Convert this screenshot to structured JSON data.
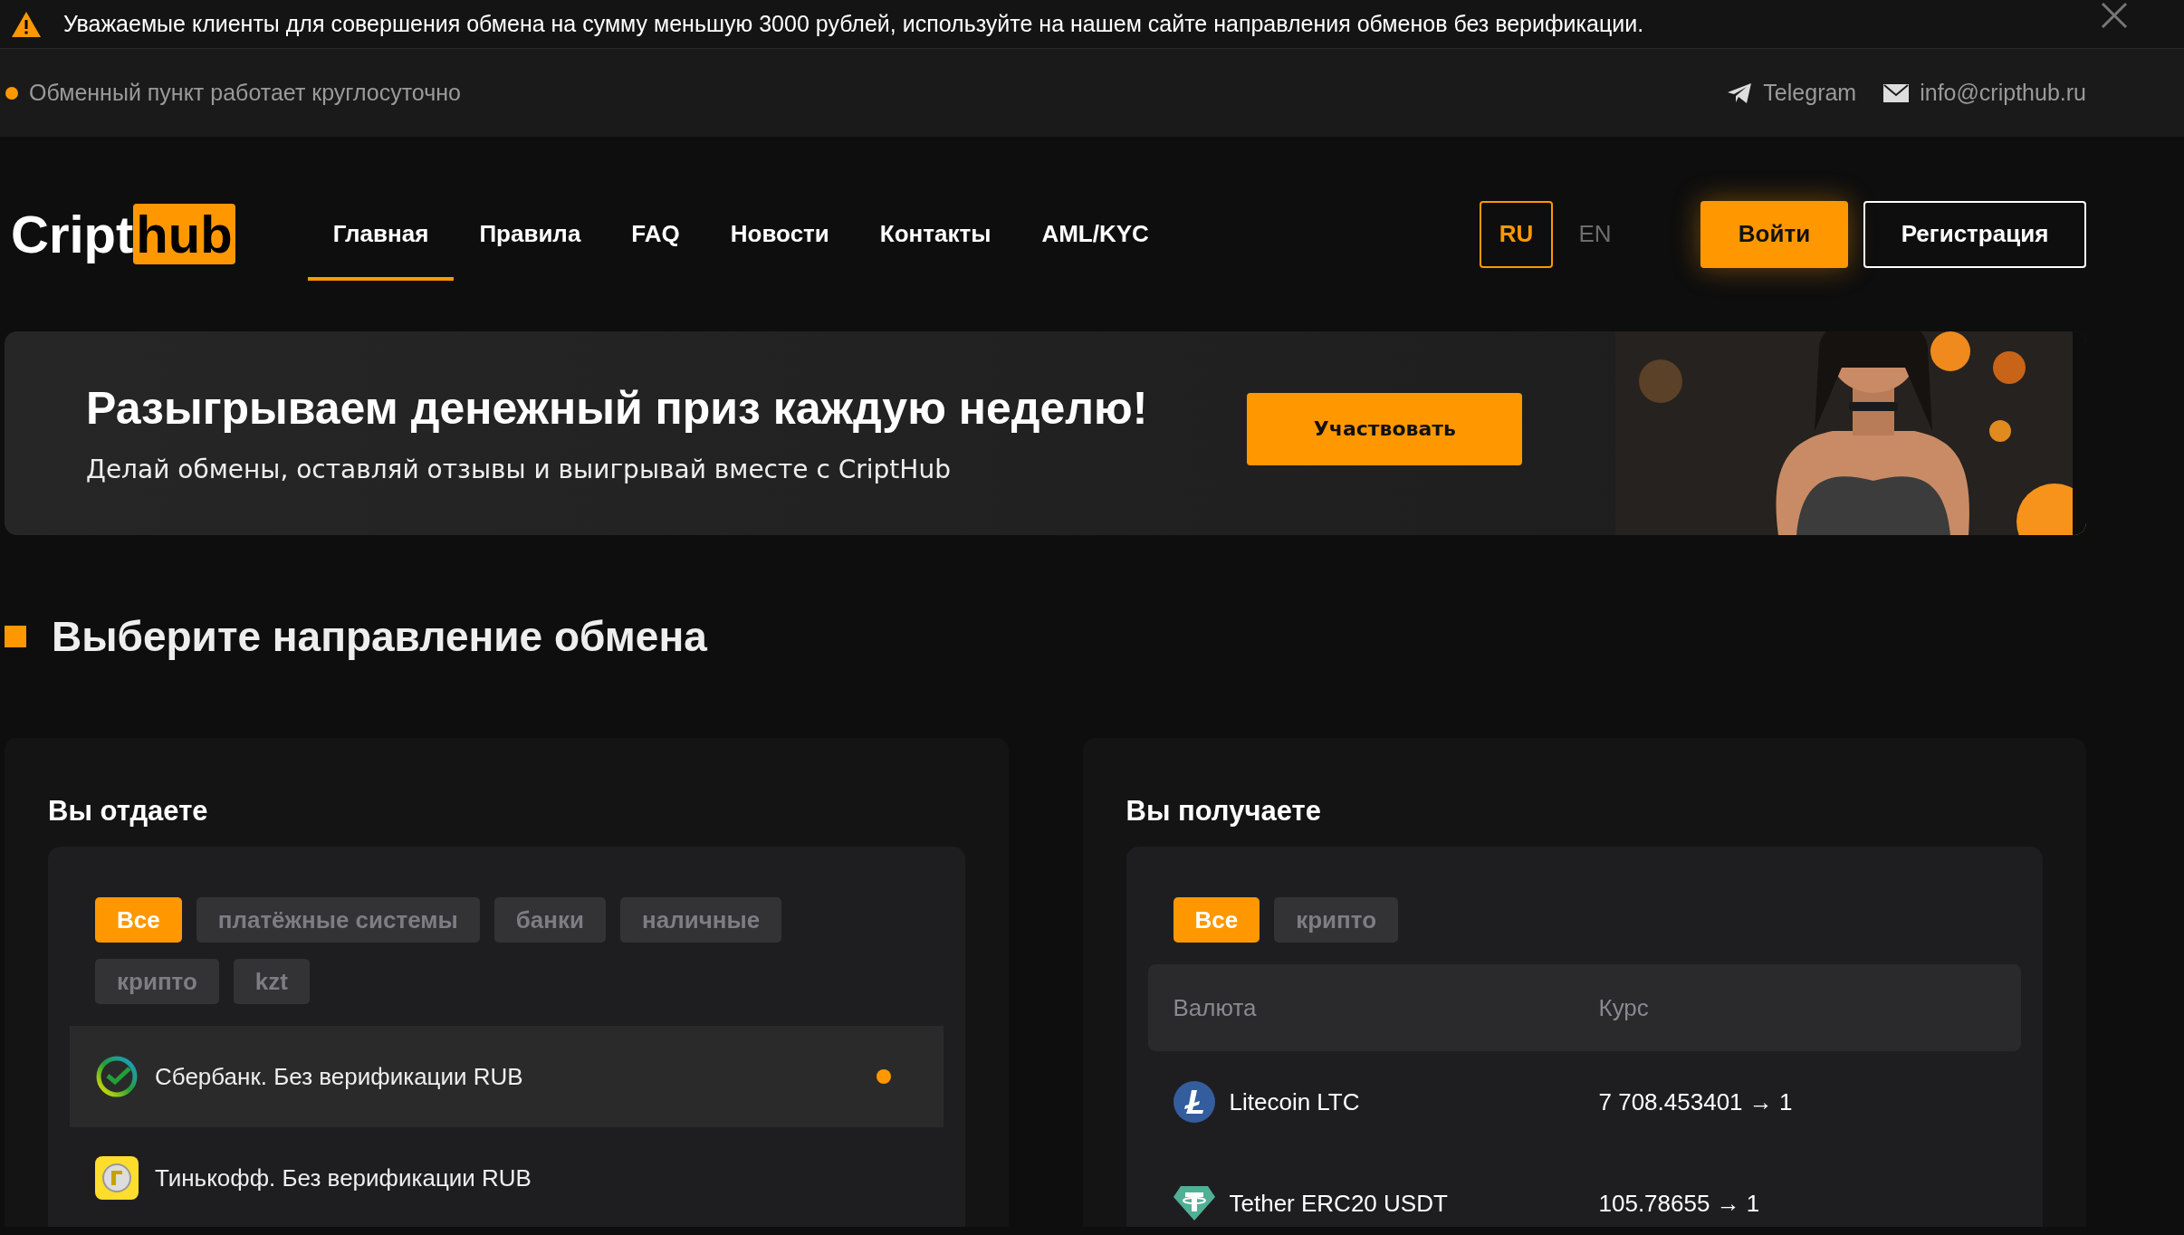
{
  "notice": {
    "text": "Уважаемые клиенты для совершения обмена на сумму меньшую 3000 рублей, используйте на нашем сайте направления обменов без верификации."
  },
  "info_bar": {
    "status": "Обменный пункт работает круглосуточно",
    "links": [
      "Telegram",
      "info@cripthub.ru"
    ]
  },
  "header": {
    "logo": {
      "part_1": "Cript",
      "part_2": "hub"
    },
    "nav": [
      {
        "label": "Главная",
        "selected": true
      },
      {
        "label": "Правила",
        "selected": false
      },
      {
        "label": "FAQ",
        "selected": false
      },
      {
        "label": "Новости",
        "selected": false
      },
      {
        "label": "Контакты",
        "selected": false
      },
      {
        "label": "AML/KYC",
        "selected": false
      }
    ],
    "languages": [
      {
        "label": "RU",
        "selected": true
      },
      {
        "label": "EN",
        "selected": false
      }
    ],
    "login": "Войти",
    "register": "Регистрация"
  },
  "banner": {
    "title": "Разыгрываем денежный приз каждую неделю!",
    "subtitle": "Делай обмены, оставляй отзывы и выигрывай вместе с CriptHub",
    "button": "Участвовать"
  },
  "section_title": "Выберите направление обмена",
  "give": {
    "title": "Вы отдаете",
    "filters": [
      {
        "label": "Все",
        "selected": true
      },
      {
        "label": "платёжные системы",
        "selected": false
      },
      {
        "label": "банки",
        "selected": false
      },
      {
        "label": "наличные",
        "selected": false
      },
      {
        "label": "крипто",
        "selected": false
      },
      {
        "label": "kzt",
        "selected": false
      }
    ],
    "items": [
      {
        "name": "Сбербанк. Без верификации RUB",
        "selected": true
      },
      {
        "name": "Тинькофф. Без верификации RUB",
        "selected": false
      }
    ]
  },
  "receive": {
    "title": "Вы получаете",
    "filters": [
      {
        "label": "Все",
        "selected": true
      },
      {
        "label": "крипто",
        "selected": false
      }
    ],
    "columns": [
      "Валюта",
      "Курс"
    ],
    "rows": [
      {
        "currency": "Litecoin LTC",
        "rate": "7 708.453401 → 1"
      },
      {
        "currency": "Tether ERC20 USDT",
        "rate": "105.78655 → 1"
      }
    ]
  }
}
